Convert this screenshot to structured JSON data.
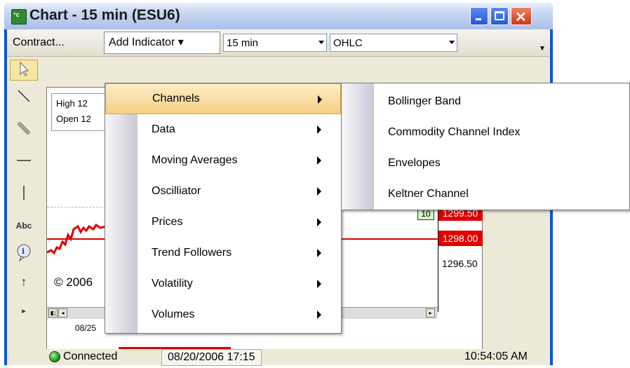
{
  "window": {
    "title": "Chart - 15 min (ESU6)",
    "app_icon_text": "°c"
  },
  "toolbar": {
    "contract_label": "Contract...",
    "add_indicator_label": "Add Indicator ▾",
    "timeframe_value": "15 min",
    "chart_type_value": "OHLC"
  },
  "tools": {
    "text_tool_label": "Abc",
    "info_label": "i",
    "up_arrow": "↑",
    "more": "▸"
  },
  "chart": {
    "high_label": "High  12",
    "open_label": "Open  12",
    "copyright": "© 2006",
    "count_badge": "10",
    "prices": [
      "1299.50",
      "1298.00",
      "1296.50"
    ],
    "date_label": "08/25",
    "colors": {
      "price_line": "#e00000",
      "price_tag": "#e00000"
    }
  },
  "status": {
    "state": "Connected",
    "date": "08/20/2006 17:15",
    "time": "10:54:05 AM"
  },
  "menu": {
    "items": [
      {
        "label": "Channels"
      },
      {
        "label": "Data"
      },
      {
        "label": "Moving Averages"
      },
      {
        "label": "Oscilliator"
      },
      {
        "label": "Prices"
      },
      {
        "label": "Trend Followers"
      },
      {
        "label": "Volatility"
      },
      {
        "label": "Volumes"
      }
    ],
    "highlighted": "Channels"
  },
  "submenu": {
    "items": [
      {
        "label": "Bollinger Band"
      },
      {
        "label": "Commodity Channel Index"
      },
      {
        "label": "Envelopes"
      },
      {
        "label": "Keltner Channel"
      }
    ]
  }
}
